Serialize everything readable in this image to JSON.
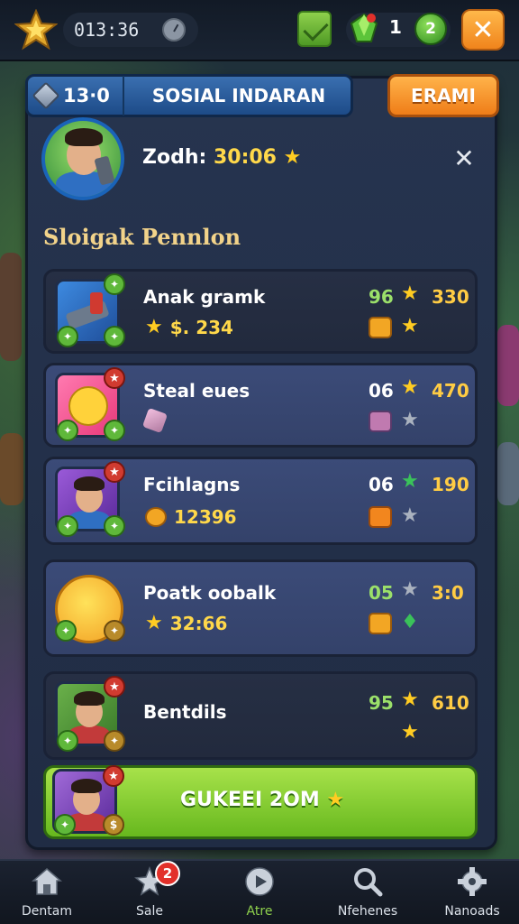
{
  "top_bar": {
    "time": "013:36",
    "gem_count": "1",
    "level_badge": "2",
    "close": "✕"
  },
  "header": {
    "level": "13·0",
    "title": "SOSIAL INDARAN",
    "action_button": "ERAMI"
  },
  "profile": {
    "name": "Zodh:",
    "time": "30:06",
    "close": "✕"
  },
  "section_title": "Sloigak Pennlon",
  "rows": [
    {
      "name": "Anak gramk",
      "sub_value": "$. 234",
      "num": "96",
      "right_value": "330"
    },
    {
      "name": "Steal eues",
      "sub_value": "",
      "num": "06",
      "right_value": "470"
    },
    {
      "name": "Fcihlagns",
      "sub_value": "12396",
      "num": "06",
      "right_value": "190"
    },
    {
      "name": "Poatk oobalk",
      "sub_value": "32:66",
      "num": "05",
      "right_value": "3:0"
    },
    {
      "name": "Bentdils",
      "sub_value": "",
      "num": "95",
      "right_value": "610"
    }
  ],
  "claim_button": "GUKEEI 2OM",
  "bottom_nav": {
    "items": [
      {
        "label": "Dentam"
      },
      {
        "label": "Sale"
      },
      {
        "label": "Atre"
      },
      {
        "label": "Nfehenes"
      },
      {
        "label": "Nanoads"
      }
    ],
    "sale_badge": "2"
  },
  "colors": {
    "accent_orange": "#f0841c",
    "accent_green": "#67b81e",
    "panel_blue": "#26344f",
    "gold": "#ffd84a"
  }
}
